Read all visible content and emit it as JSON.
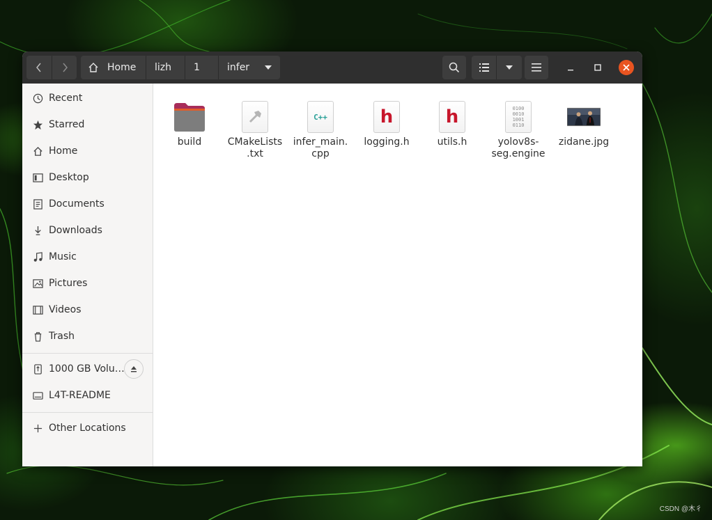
{
  "window": {
    "breadcrumbs": [
      "Home",
      "lizh",
      "1",
      "infer"
    ]
  },
  "sidebar": {
    "places": [
      {
        "label": "Recent",
        "icon": "clock-icon"
      },
      {
        "label": "Starred",
        "icon": "star-icon"
      },
      {
        "label": "Home",
        "icon": "home-icon"
      },
      {
        "label": "Desktop",
        "icon": "desktop-icon"
      },
      {
        "label": "Documents",
        "icon": "document-icon"
      },
      {
        "label": "Downloads",
        "icon": "download-icon"
      },
      {
        "label": "Music",
        "icon": "music-icon"
      },
      {
        "label": "Pictures",
        "icon": "picture-icon"
      },
      {
        "label": "Videos",
        "icon": "video-icon"
      },
      {
        "label": "Trash",
        "icon": "trash-icon"
      }
    ],
    "devices": [
      {
        "label": "1000 GB Volu…",
        "icon": "usb-drive-icon"
      },
      {
        "label": "L4T-README",
        "icon": "drive-icon"
      }
    ],
    "other": {
      "label": "Other Locations",
      "icon": "plus-icon"
    }
  },
  "files": [
    {
      "name": "build",
      "type": "folder"
    },
    {
      "name": "CMakeLists\n.txt",
      "type": "cmake"
    },
    {
      "name": "infer_main.\ncpp",
      "type": "cpp",
      "badge": "C++"
    },
    {
      "name": "logging.h",
      "type": "header",
      "badge": "h"
    },
    {
      "name": "utils.h",
      "type": "header",
      "badge": "h"
    },
    {
      "name": "yolov8s-\nseg.engine",
      "type": "binary",
      "badge": "0100\n0010\n1001\n0110"
    },
    {
      "name": "zidane.jpg",
      "type": "image"
    }
  ],
  "watermark": "CSDN @木彳",
  "colors": {
    "accent": "#e95420",
    "header_h": "#c7162b",
    "cpp": "#2aa198",
    "folder": "#7d7d7d",
    "folder_top": "#a82d5a"
  }
}
